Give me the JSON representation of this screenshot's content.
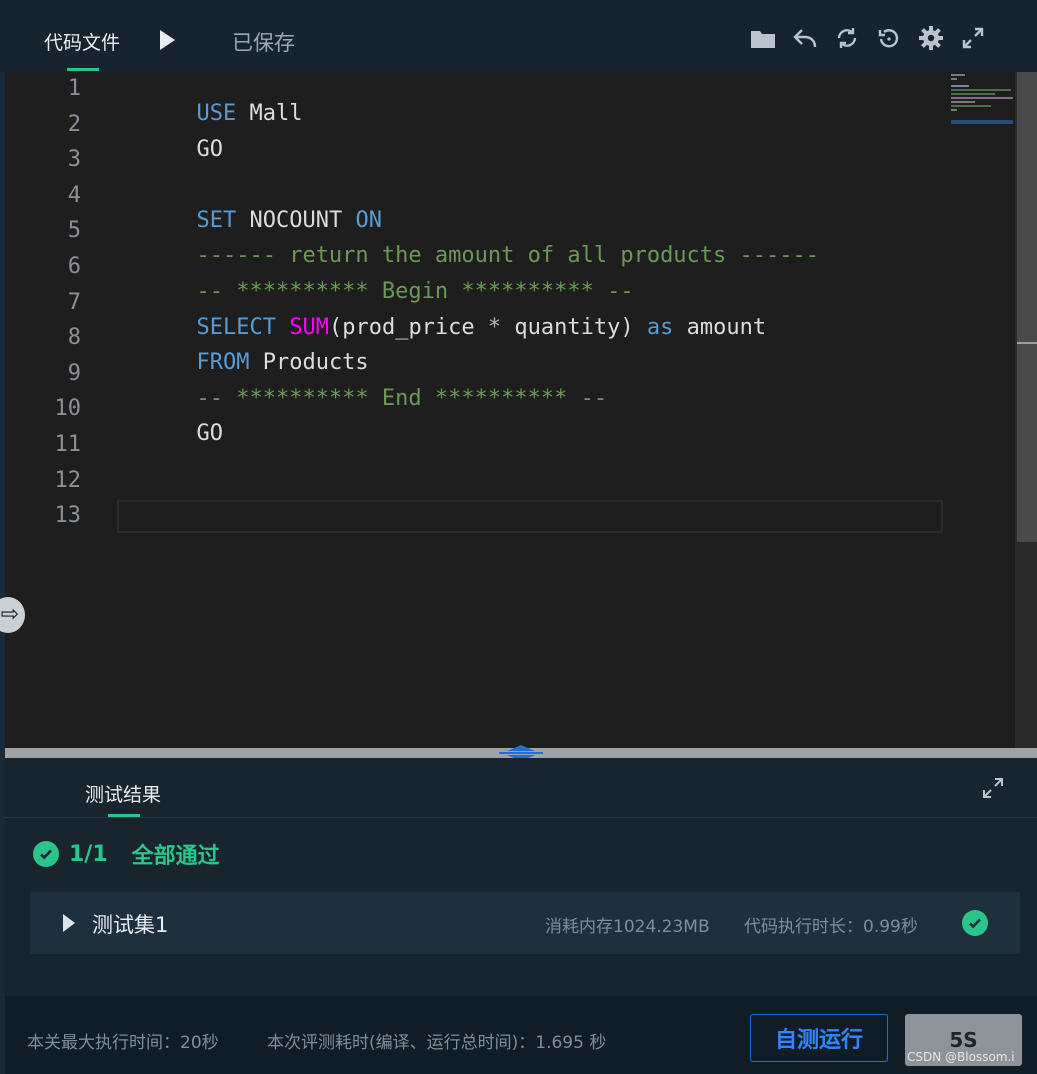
{
  "header": {
    "file_tab": "代码文件",
    "saved_status": "已保存",
    "tools": [
      "folder-icon",
      "undo-icon",
      "refresh-icon",
      "restore-icon",
      "gear-icon",
      "fullscreen-icon"
    ]
  },
  "editor": {
    "line_numbers": [
      "1",
      "2",
      "3",
      "4",
      "5",
      "6",
      "7",
      "8",
      "9",
      "10",
      "11",
      "12",
      "13"
    ],
    "lines": {
      "l1_kw": "USE",
      "l1_rest": " Mall",
      "l2": "GO",
      "l4_kw1": "SET",
      "l4_mid": " NOCOUNT ",
      "l4_kw2": "ON",
      "l5": "------ return the amount of all products ------",
      "l6": "-- ********** Begin ********** --",
      "l7_kw": "SELECT",
      "l7_sp": " ",
      "l7_fn": "SUM",
      "l7_a": "(prod_price ",
      "l7_op": "*",
      "l7_b": " quantity) ",
      "l7_as": "as",
      "l7_c": " amount",
      "l8_kw": "FROM",
      "l8_rest": " Products",
      "l9": "-- ********** End ********** --",
      "l10": "GO"
    },
    "current_line": 13
  },
  "colors": {
    "keyword": "#569cd6",
    "function": "#ff00ff",
    "comment": "#6a9955",
    "success": "#2bc48a",
    "primary_button": "#2f86ff"
  },
  "results": {
    "tab_label": "测试结果",
    "pass_count": "1/1",
    "pass_text": "全部通过",
    "testset": {
      "name": "测试集1",
      "memory": "消耗内存1024.23MB",
      "exec_time": "代码执行时长：0.99秒"
    }
  },
  "footer": {
    "max_time": "本关最大执行时间：20秒",
    "eval_time": "本次评测耗时(编译、运行总时间)：1.695 秒",
    "self_test_button": "自测运行",
    "eval_button": "5S",
    "watermark": "CSDN @Blossom.i"
  }
}
